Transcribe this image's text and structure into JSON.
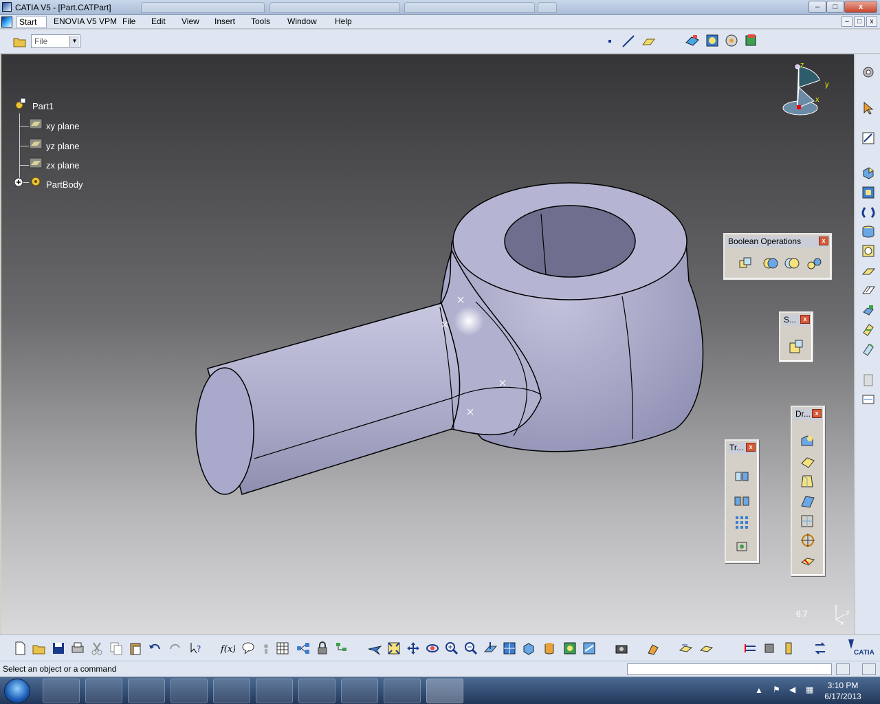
{
  "window": {
    "title": "CATIA V5 - [Part.CATPart]",
    "minimize_label": "–",
    "maximize_label": "□",
    "close_label": "x"
  },
  "menubar": {
    "start": "Start",
    "enovia": "ENOVIA V5 VPM",
    "file": "File",
    "edit": "Edit",
    "view": "View",
    "insert": "Insert",
    "tools": "Tools",
    "window": "Window",
    "help": "Help",
    "mdi_min": "–",
    "mdi_max": "□",
    "mdi_close": "x"
  },
  "toolbar": {
    "workbench_combo_value": "File"
  },
  "tree": {
    "root": "Part1",
    "items": [
      "xy plane",
      "yz plane",
      "zx plane"
    ],
    "body": "PartBody"
  },
  "compass": {
    "x": "x",
    "y": "y",
    "z": "z"
  },
  "floating_toolbars": {
    "boolean": {
      "title": "Boolean Operations"
    },
    "surface": {
      "title": "S..."
    },
    "dress": {
      "title": "Dr..."
    },
    "transform": {
      "title": "Tr..."
    },
    "close": "x"
  },
  "viewport": {
    "scale_readout": "6.7",
    "axis_z": "z",
    "axis_y": "y",
    "axis_x": "x"
  },
  "status": {
    "prompt": "Select an object or a command"
  },
  "taskbar": {
    "time": "3:10 PM",
    "date": "6/17/2013"
  },
  "colors": {
    "part_fill": "#b4b4cf",
    "part_dark": "#8d8db0",
    "viewport_top": "#353538",
    "viewport_bottom": "#d9d9db",
    "tree_text": "#ffffff"
  }
}
